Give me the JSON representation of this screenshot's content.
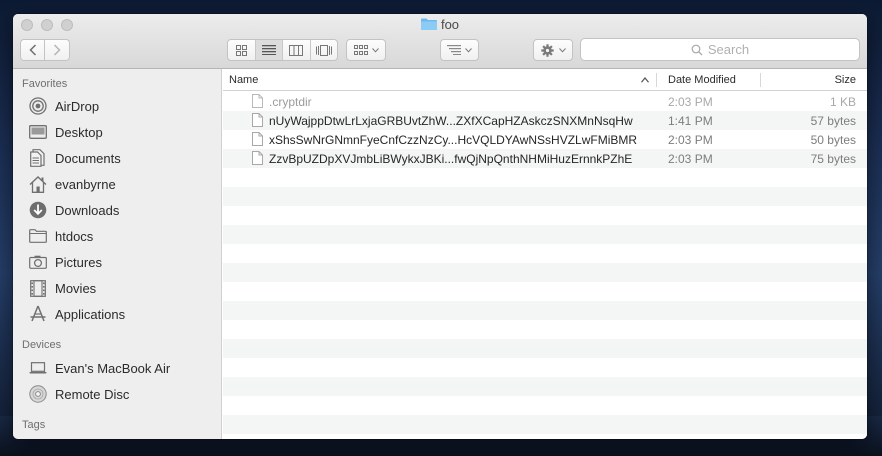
{
  "window": {
    "title": "foo"
  },
  "toolbar": {
    "search_placeholder": "Search"
  },
  "sidebar": {
    "favorites_title": "Favorites",
    "favorites": [
      {
        "label": "AirDrop",
        "icon": "airdrop-icon"
      },
      {
        "label": "Desktop",
        "icon": "desktop-icon"
      },
      {
        "label": "Documents",
        "icon": "documents-icon"
      },
      {
        "label": "evanbyrne",
        "icon": "home-icon"
      },
      {
        "label": "Downloads",
        "icon": "downloads-icon"
      },
      {
        "label": "htdocs",
        "icon": "folder-icon"
      },
      {
        "label": "Pictures",
        "icon": "camera-icon"
      },
      {
        "label": "Movies",
        "icon": "film-icon"
      },
      {
        "label": "Applications",
        "icon": "applications-icon"
      }
    ],
    "devices_title": "Devices",
    "devices": [
      {
        "label": "Evan's MacBook Air",
        "icon": "laptop-icon"
      },
      {
        "label": "Remote Disc",
        "icon": "disc-icon"
      }
    ],
    "tags_title": "Tags"
  },
  "list": {
    "columns": {
      "name": "Name",
      "date": "Date Modified",
      "size": "Size"
    },
    "rows": [
      {
        "name": ".cryptdir",
        "date": "2:03 PM",
        "size": "1 KB"
      },
      {
        "name": "nUyWajppDtwLrLxjaGRBUvtZhW...ZXfXCapHZAskczSNXMnNsqHw",
        "date": "1:41 PM",
        "size": "57 bytes"
      },
      {
        "name": "xShsSwNrGNmnFyeCnfCzzNzCy...HcVQLDYAwNSsHVZLwFMiBMR",
        "date": "2:03 PM",
        "size": "50 bytes"
      },
      {
        "name": "ZzvBpUZDpXVJmbLiBWykxJBKi...fwQjNpQnthNHMiHuzErnnkPZhE",
        "date": "2:03 PM",
        "size": "75 bytes"
      }
    ]
  },
  "colors": {
    "folder_blue": "#6cb8ef",
    "sidebar_bg": "#eeeeee",
    "row_alt": "#f4f5f5"
  }
}
